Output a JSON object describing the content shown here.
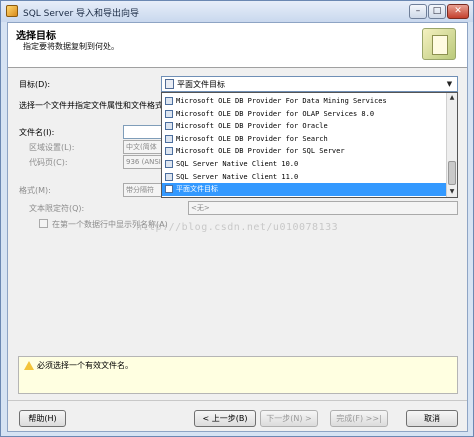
{
  "window": {
    "title": "SQL Server 导入和导出向导",
    "min_glyph": "–",
    "max_glyph": "□",
    "close_glyph": "✕"
  },
  "header": {
    "title": "选择目标",
    "subtitle": "指定要将数据复制到何处。"
  },
  "destination": {
    "label": "目标(D):",
    "selected": "平面文件目标",
    "arrow": "▼"
  },
  "dropdown": {
    "items": [
      "Microsoft OLE DB Provider For Data Mining Services",
      "Microsoft OLE DB Provider for OLAP Services 8.0",
      "Microsoft OLE DB Provider for Oracle",
      "Microsoft OLE DB Provider for Search",
      "Microsoft OLE DB Provider for SQL Server",
      "SQL Server Native Client 10.0",
      "SQL Server Native Client 11.0",
      "平面文件目标"
    ],
    "selected_index": 7,
    "up_glyph": "▲",
    "down_glyph": "▼"
  },
  "form": {
    "instruction": "选择一个文件并指定文件属性和文件格式",
    "filename_label": "文件名(I):",
    "locale_label": "区域设置(L):",
    "locale_value": "中文(简体",
    "codepage_label": "代码页(C):",
    "codepage_value": "936  (ANSI",
    "format_label": "格式(M):",
    "format_value": "带分隔符",
    "qualifier_label": "文本限定符(Q):",
    "qualifier_value": "<无>",
    "header_row_label": "在第一个数据行中显示列名称(A)"
  },
  "watermark": "http://blog.csdn.net/u010078133",
  "message": "必须选择一个有效文件名。",
  "buttons": {
    "help": "帮助(H)",
    "back": "< 上一步(B)",
    "next": "下一步(N) >",
    "finish": "完成(F) >>|",
    "cancel": "取消"
  }
}
